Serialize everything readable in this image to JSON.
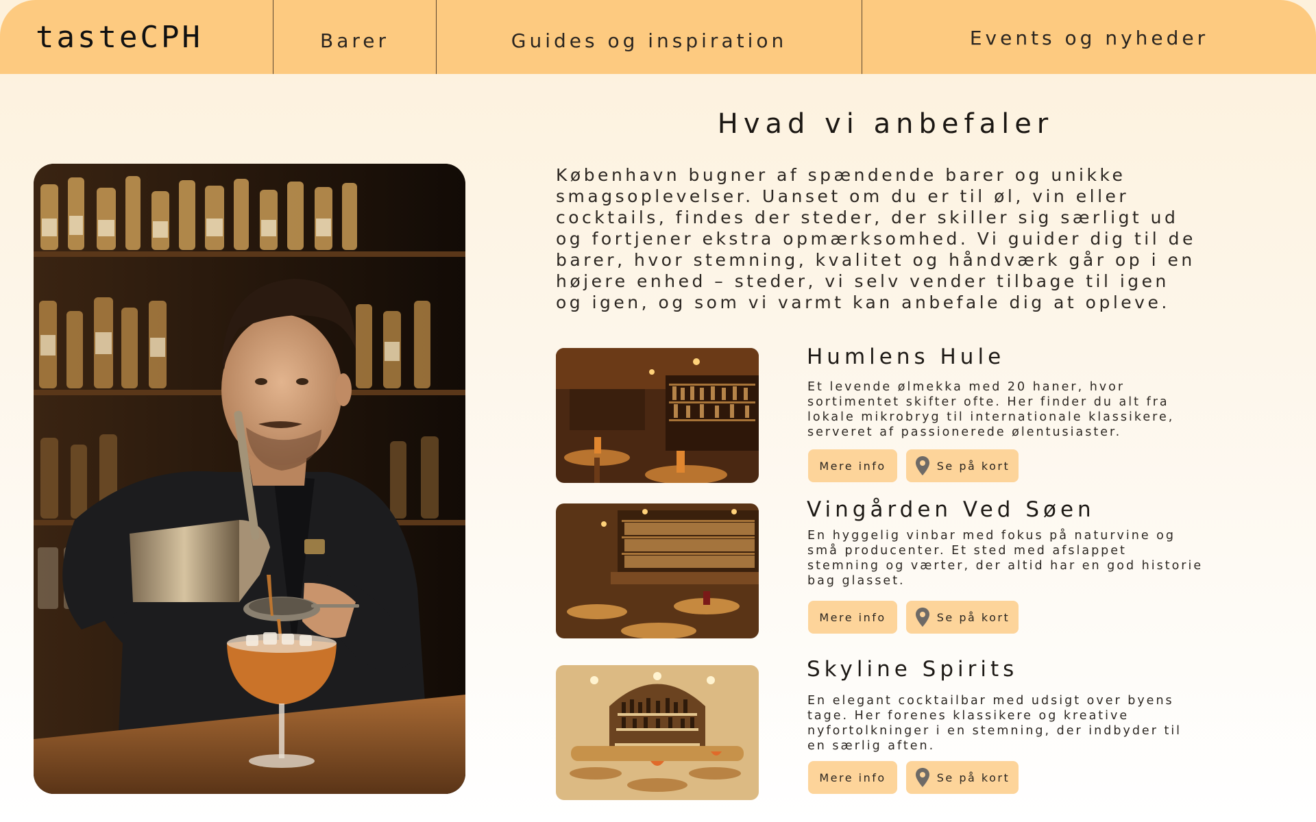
{
  "nav": {
    "logo": "tasteCPH",
    "items": [
      "Barer",
      "Guides og inspiration",
      "Events og nyheder"
    ]
  },
  "hero": {
    "alt": "Bartender hælder en cocktail"
  },
  "main": {
    "title": "Hvad vi anbefaler",
    "intro": "København bugner af spændende barer og unikke smagsoplevelser. Uanset om du er til øl, vin eller cocktails, findes der steder, der skiller sig særligt ud og fortjener ekstra opmærksomhed. Vi guider dig til de barer, hvor stemning, kvalitet og håndværk går op i en højere enhed – steder, vi selv vender tilbage til igen og igen, og som vi varmt kan anbefale dig at opleve."
  },
  "cards": [
    {
      "title": "Humlens Hule",
      "description": "Et levende ølmekka med 20 haner, hvor sortimentet skifter ofte. Her finder du alt fra lokale mikrobryg til internationale klassikere, serveret af passionerede ølentusiaster.",
      "info_label": "Mere info",
      "map_label": "Se på kort"
    },
    {
      "title": "Vingården Ved Søen",
      "description": "En hyggelig vinbar med fokus på naturvine og små producenter. Et sted med afslappet stemning og værter, der altid har en god historie bag glasset.",
      "info_label": "Mere info",
      "map_label": "Se på kort"
    },
    {
      "title": "Skyline Spirits",
      "description": "En elegant cocktailbar med udsigt over byens tage. Her forenes klassikere og kreative nyfortolkninger i en stemning, der indbyder til en særlig aften.",
      "info_label": "Mere info",
      "map_label": "Se på kort"
    }
  ],
  "colors": {
    "nav_bg": "#fdca80",
    "button_bg": "#fdd49a",
    "page_bg": "#fdf1dc",
    "text": "#1e1a16"
  },
  "icons": {
    "map_button": "map-pin-icon"
  }
}
